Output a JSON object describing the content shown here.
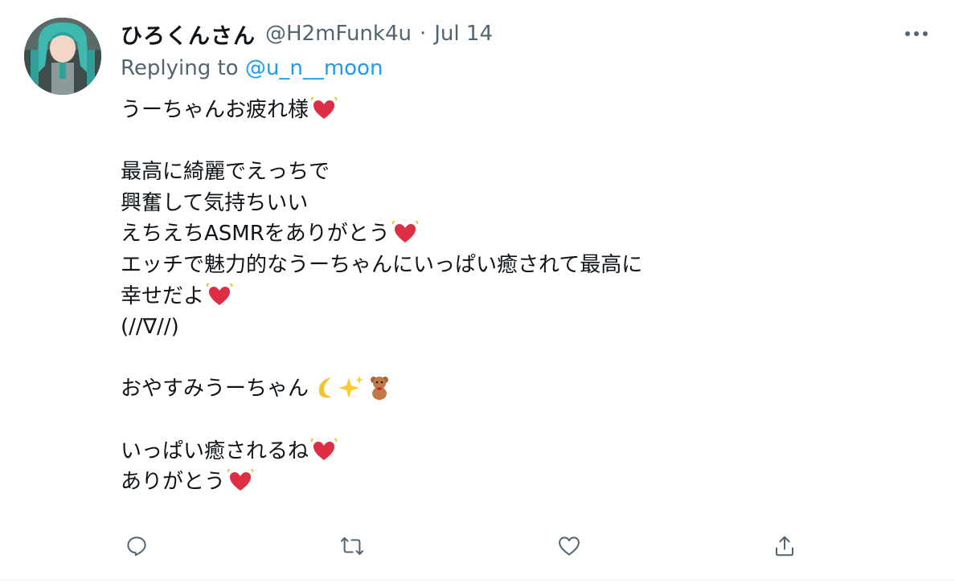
{
  "tweet": {
    "author_name": "ひろくんさん",
    "author_handle": "@H2mFunk4u",
    "separator": "·",
    "date": "Jul 14",
    "replying_prefix": "Replying to",
    "replying_to": "@u_n__moon",
    "avatar_icon": "avatar-image",
    "more_icon": "more-dots-icon",
    "lines": [
      "うーちゃんお疲れ様",
      "",
      "最高に綺麗でえっちで",
      "興奮して気持ちいい",
      "えちえちASMRをありがとう",
      "エッチで魅力的なうーちゃんにいっぱい癒されて最高に",
      "幸せだよ",
      "(//∇//)",
      "",
      "おやすみうーちゃん",
      "",
      "いっぱい癒されるね",
      "ありがとう"
    ],
    "emojis": {
      "heart": "beating-heart-emoji",
      "moon": "crescent-moon-emoji",
      "sparkles": "sparkles-emoji",
      "bear": "teddy-bear-emoji"
    }
  },
  "actions": [
    {
      "name": "reply",
      "icon": "reply-icon"
    },
    {
      "name": "retweet",
      "icon": "retweet-icon"
    },
    {
      "name": "like",
      "icon": "heart-icon"
    },
    {
      "name": "share",
      "icon": "share-icon"
    }
  ],
  "colors": {
    "text": "#0f1419",
    "secondary": "#536471",
    "link": "#1d9bf0",
    "heart_emoji": "#dd2e44"
  }
}
